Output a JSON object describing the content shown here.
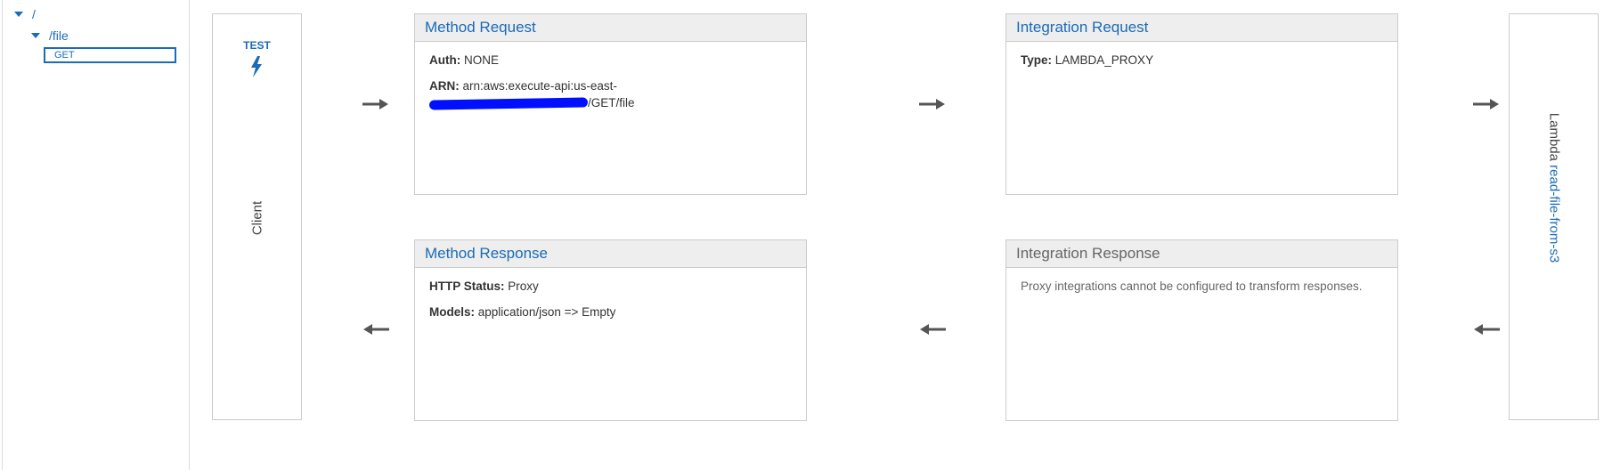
{
  "tree": {
    "root_label": "/",
    "file_label": "/file",
    "method_label": "GET"
  },
  "client": {
    "test_label": "TEST",
    "label": "Client"
  },
  "method_request": {
    "title": "Method Request",
    "auth_key": "Auth:",
    "auth_value": "NONE",
    "arn_key": "ARN:",
    "arn_value_line1": "arn:aws:execute-api:us-east-",
    "arn_value_suffix": "/GET/file"
  },
  "integration_request": {
    "title": "Integration Request",
    "type_key": "Type:",
    "type_value": "LAMBDA_PROXY"
  },
  "method_response": {
    "title": "Method Response",
    "status_key": "HTTP Status:",
    "status_value": "Proxy",
    "models_key": "Models:",
    "models_value": "application/json => Empty"
  },
  "integration_response": {
    "title": "Integration Response",
    "message": "Proxy integrations cannot be configured to transform responses."
  },
  "lambda": {
    "prefix": "Lambda",
    "function_name": "read-file-from-s3"
  },
  "colors": {
    "link_blue": "#1a6bb8",
    "arrow_gray": "#555555",
    "border_gray": "#cccccc",
    "header_bg": "#eeeeee",
    "redaction_blue": "#0010ff"
  },
  "icons": {
    "test": "lightning-bolt-icon",
    "arrow_right": "arrow-right-icon",
    "arrow_left": "arrow-left-icon",
    "tree_expand": "caret-down-icon"
  }
}
